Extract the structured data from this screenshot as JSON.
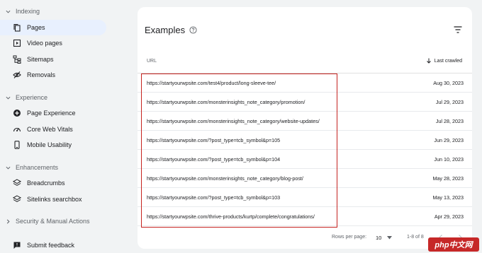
{
  "sidebar": {
    "sections": [
      {
        "label": "Indexing",
        "expanded": true,
        "items": [
          {
            "label": "Pages",
            "icon": "pages-icon",
            "active": true
          },
          {
            "label": "Video pages",
            "icon": "video-pages-icon",
            "active": false
          },
          {
            "label": "Sitemaps",
            "icon": "sitemaps-icon",
            "active": false
          },
          {
            "label": "Removals",
            "icon": "removals-icon",
            "active": false
          }
        ]
      },
      {
        "label": "Experience",
        "expanded": true,
        "items": [
          {
            "label": "Page Experience",
            "icon": "page-experience-icon",
            "active": false
          },
          {
            "label": "Core Web Vitals",
            "icon": "core-web-vitals-icon",
            "active": false
          },
          {
            "label": "Mobile Usability",
            "icon": "mobile-usability-icon",
            "active": false
          }
        ]
      },
      {
        "label": "Enhancements",
        "expanded": true,
        "items": [
          {
            "label": "Breadcrumbs",
            "icon": "breadcrumbs-icon",
            "active": false
          },
          {
            "label": "Sitelinks searchbox",
            "icon": "sitelinks-searchbox-icon",
            "active": false
          }
        ]
      },
      {
        "label": "Security & Manual Actions",
        "expanded": false,
        "items": []
      }
    ],
    "submit_feedback": "Submit feedback"
  },
  "examples": {
    "title": "Examples",
    "columns": {
      "url": "URL",
      "last_crawled": "Last crawled"
    },
    "rows": [
      {
        "url": "https://startyourwpsite.com/test4/product/long-sleeve-tee/",
        "date": "Aug 30, 2023"
      },
      {
        "url": "https://startyourwpsite.com/monsterinsights_note_category/promotion/",
        "date": "Jul 29, 2023"
      },
      {
        "url": "https://startyourwpsite.com/monsterinsights_note_category/website-updates/",
        "date": "Jul 28, 2023"
      },
      {
        "url": "https://startyourwpsite.com/?post_type=tcb_symbol&p=105",
        "date": "Jun 29, 2023"
      },
      {
        "url": "https://startyourwpsite.com/?post_type=tcb_symbol&p=104",
        "date": "Jun 10, 2023"
      },
      {
        "url": "https://startyourwpsite.com/monsterinsights_note_category/blog-post/",
        "date": "May 28, 2023"
      },
      {
        "url": "https://startyourwpsite.com/?post_type=tcb_symbol&p=103",
        "date": "May 13, 2023"
      },
      {
        "url": "https://startyourwpsite.com/thrive-products/kurtp/complete/congratulations/",
        "date": "Apr 29, 2023"
      }
    ],
    "footer": {
      "rows_per_page_label": "Rows per page:",
      "rows_per_page_value": "10",
      "range": "1-8 of 8"
    }
  },
  "watermark": "php中文网",
  "colors": {
    "active_bg": "#e8f0fe",
    "highlight_border": "#c5221f",
    "watermark_bg": "#c62828"
  }
}
